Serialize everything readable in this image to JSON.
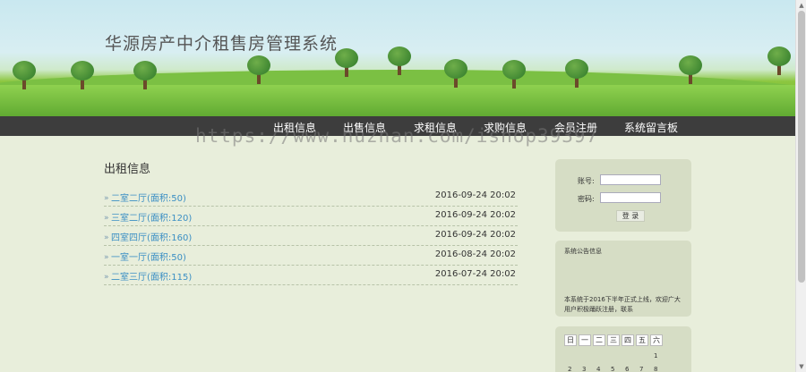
{
  "header": {
    "title": "华源房产中介租售房管理系统"
  },
  "nav": {
    "items": [
      "出租信息",
      "出售信息",
      "求租信息",
      "求购信息",
      "会员注册",
      "系统留言板"
    ]
  },
  "watermark": "https://www.huzhan.com/ishop39397",
  "main": {
    "section_title": "出租信息",
    "bullet": "»",
    "listings": [
      {
        "title": "二室二厅(面积:50)",
        "date": "2016-09-24 20:02"
      },
      {
        "title": "三室二厅(面积:120)",
        "date": "2016-09-24 20:02"
      },
      {
        "title": "四室四厅(面积:160)",
        "date": "2016-09-24 20:02"
      },
      {
        "title": "一室一厅(面积:50)",
        "date": "2016-08-24 20:02"
      },
      {
        "title": "二室三厅(面积:115)",
        "date": "2016-07-24 20:02"
      }
    ]
  },
  "login": {
    "username_label": "账号:",
    "password_label": "密码:",
    "submit_label": "登 录"
  },
  "notice": {
    "title": "系统公告信息",
    "text": "本系统于2016下半年正式上线，欢迎广大用户积极踊跃注册，联系"
  },
  "calendar": {
    "weekdays": [
      "日",
      "一",
      "二",
      "三",
      "四",
      "五",
      "六"
    ],
    "row1": [
      "1"
    ],
    "row2": [
      "2",
      "3",
      "4",
      "5",
      "6",
      "7",
      "8"
    ]
  },
  "colors": {
    "nav_bg": "#3d3d3d",
    "link": "#3b8fc4",
    "page_bg": "#e8eedb",
    "panel_bg": "#d6ddc5"
  },
  "icons": {
    "scroll_up": "▲",
    "scroll_down": "▼"
  }
}
